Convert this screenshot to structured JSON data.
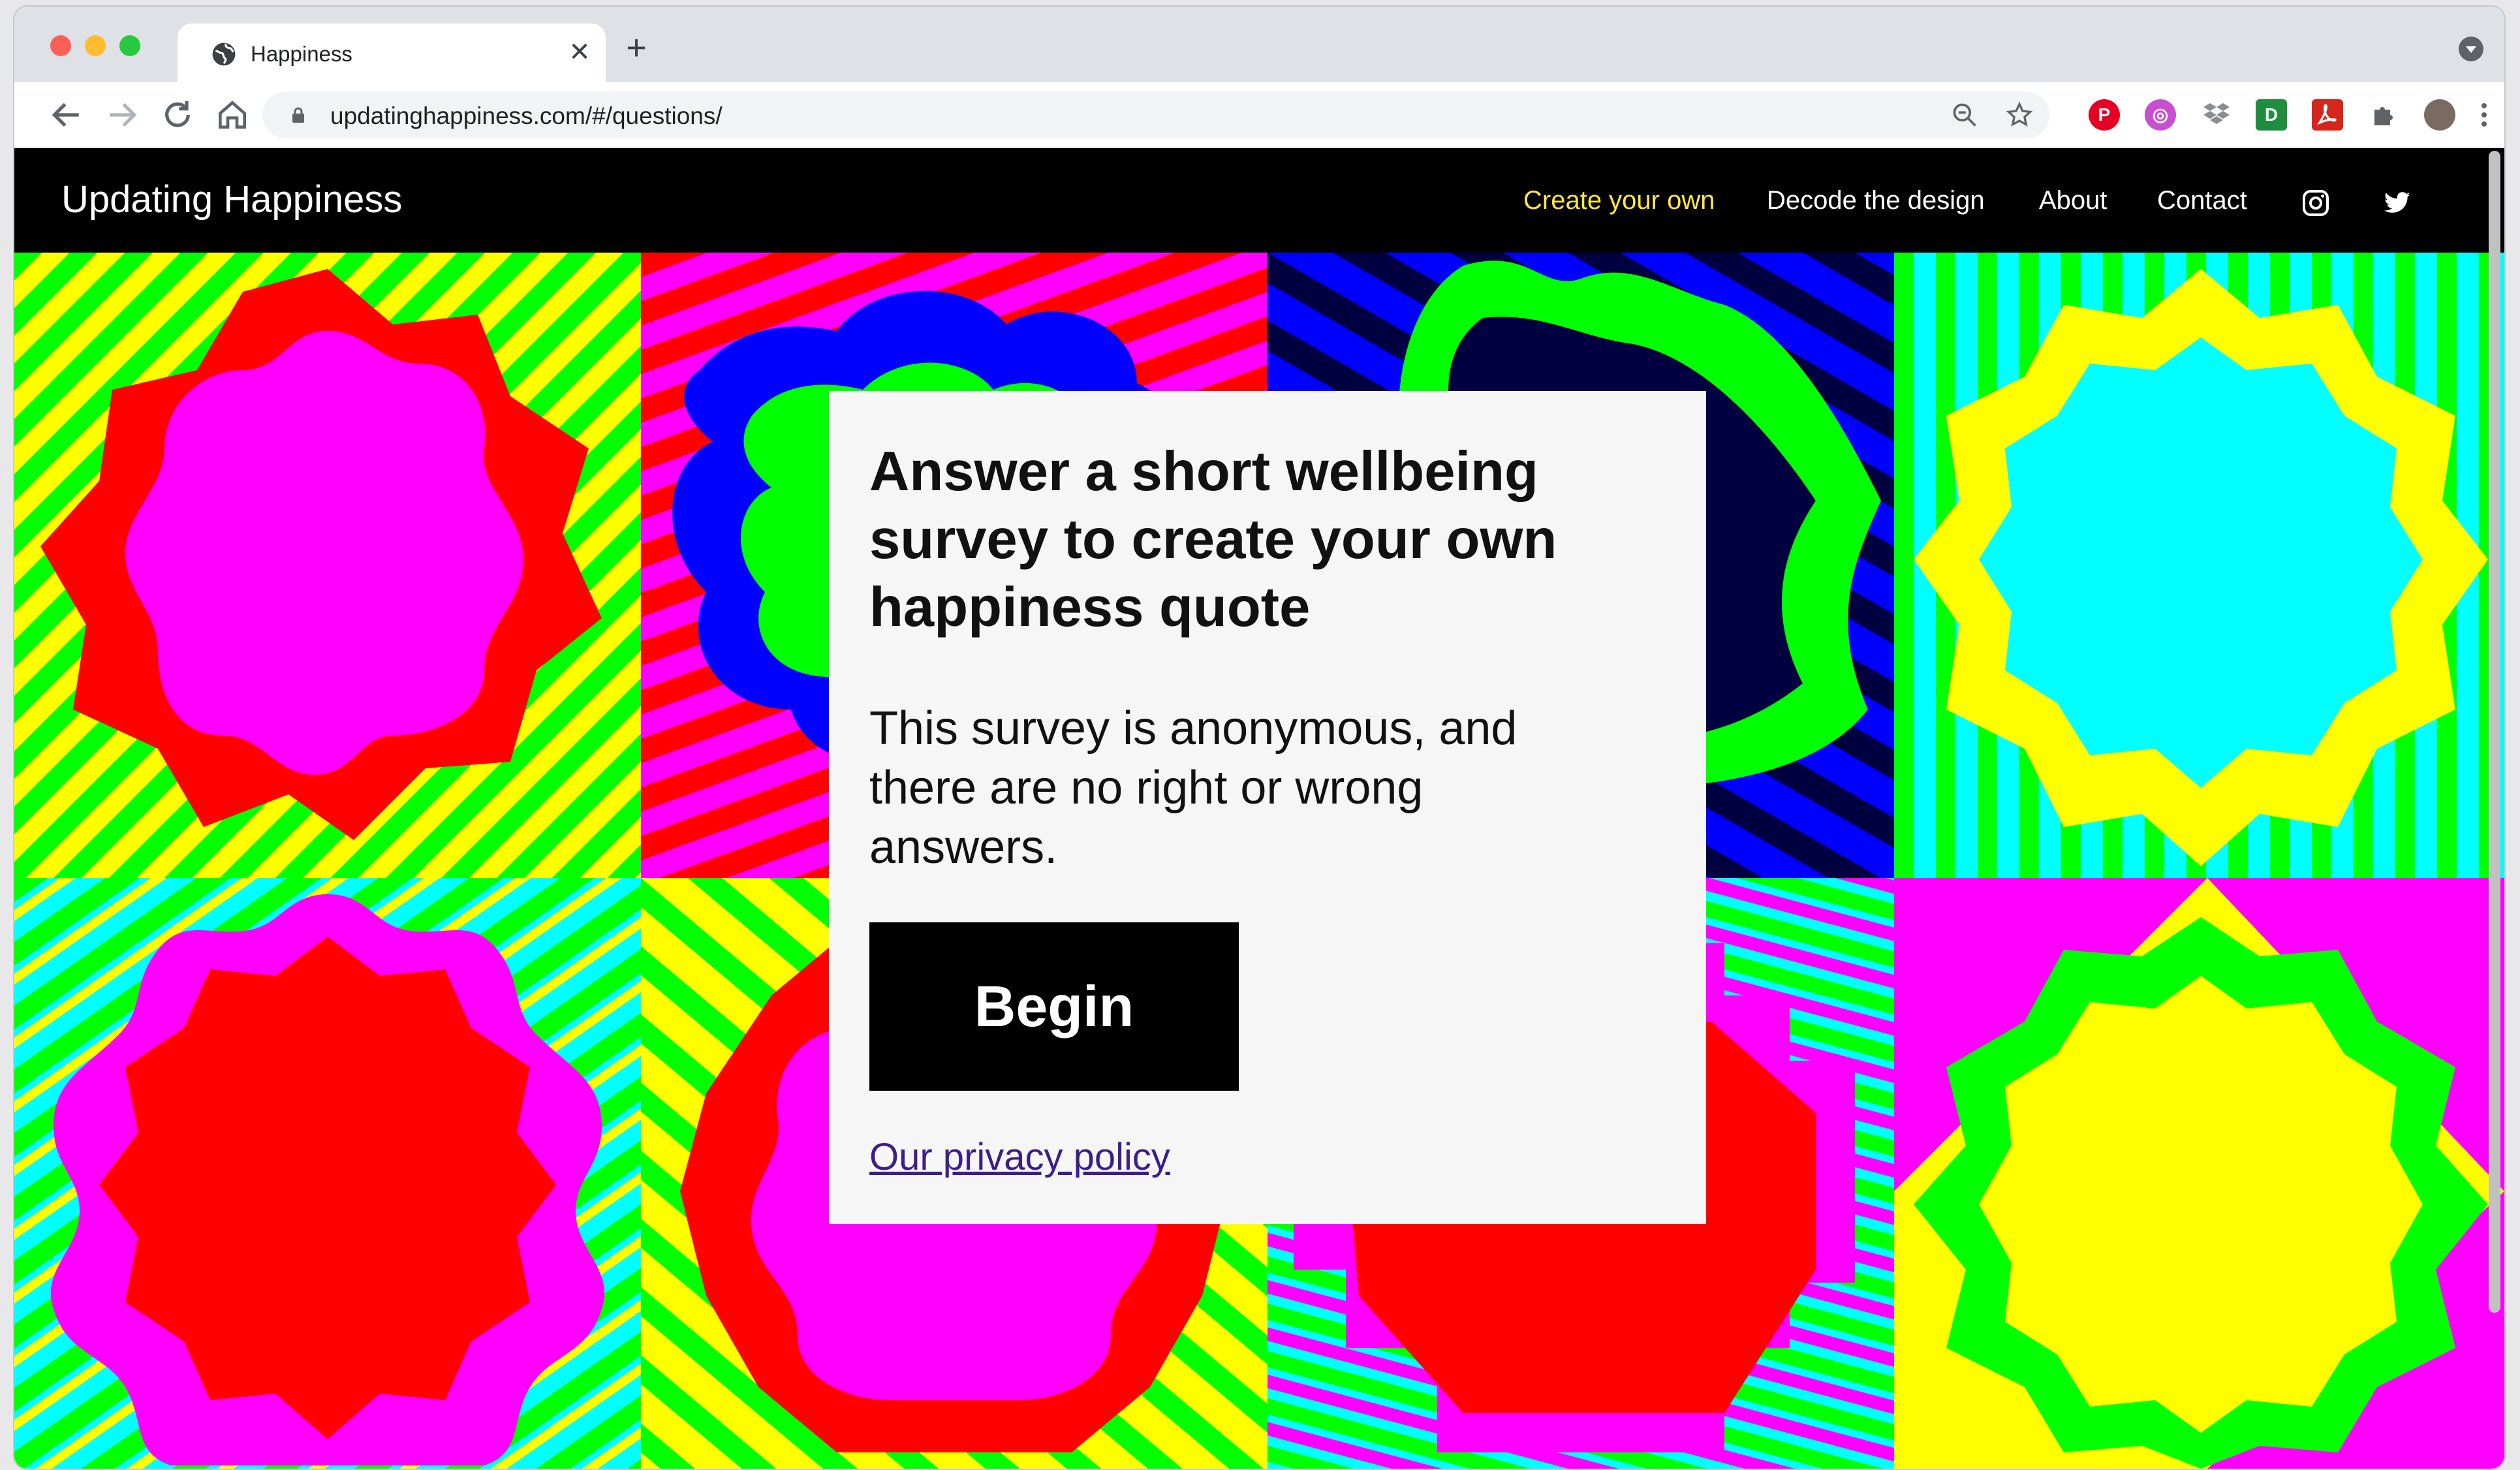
{
  "browser": {
    "tab_title": "Happiness",
    "tab_close_glyph": "✕",
    "new_tab_glyph": "+",
    "url": "updatinghappiness.com/#/questions/",
    "icons": [
      "back-icon",
      "forward-icon",
      "reload-icon",
      "home-icon",
      "lock-icon",
      "zoom-icon",
      "star-icon",
      "pinterest-icon",
      "extension-icon",
      "dropbox-icon",
      "d-extension-icon",
      "pdf-icon",
      "puzzle-icon",
      "avatar",
      "menu-icon"
    ],
    "ext_d_label": "D"
  },
  "site": {
    "brand": "Updating Happiness",
    "nav": [
      {
        "label": "Create your own",
        "active": true
      },
      {
        "label": "Decode the design"
      },
      {
        "label": "About"
      },
      {
        "label": "Contact"
      }
    ],
    "colors": {
      "active_nav": "#ffe83b",
      "red": "#ff0000",
      "magenta": "#ff00ff",
      "yellow": "#ffff00",
      "green": "#00ff00",
      "cyan": "#00ffff",
      "blue": "#0000ff",
      "navy": "#000040"
    }
  },
  "card": {
    "heading": "Answer a short wellbeing survey to create your own happiness quote",
    "body": "This survey is anonymous, and there are no right or wrong answers.",
    "button": "Begin",
    "link": "Our privacy policy"
  }
}
